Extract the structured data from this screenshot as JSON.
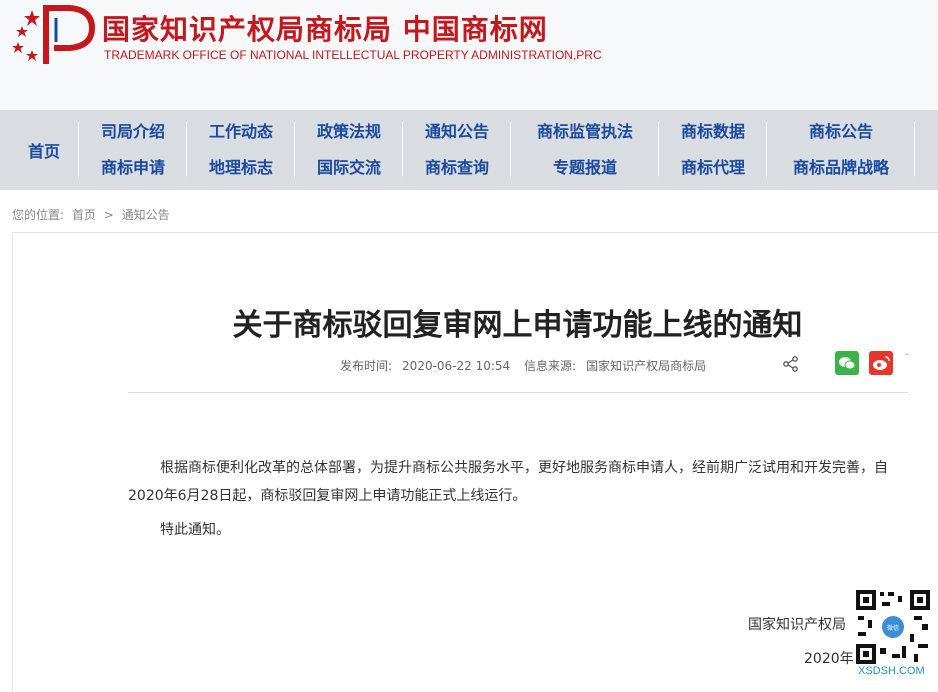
{
  "header": {
    "title_cn": "国家知识产权局商标局 中国商标网",
    "title_en": "TRADEMARK OFFICE OF NATIONAL INTELLECTUAL PROPERTY ADMINISTRATION,PRC",
    "brand_color": "#c4181c"
  },
  "nav": {
    "home": "首页",
    "columns": [
      {
        "top": "司局介绍",
        "bottom": "商标申请"
      },
      {
        "top": "工作动态",
        "bottom": "地理标志"
      },
      {
        "top": "政策法规",
        "bottom": "国际交流"
      },
      {
        "top": "通知公告",
        "bottom": "商标查询"
      },
      {
        "top": "商标监管执法",
        "bottom": "专题报道"
      },
      {
        "top": "商标数据",
        "bottom": "商标代理"
      },
      {
        "top": "商标公告",
        "bottom": "商标品牌战略"
      }
    ],
    "link_color": "#1a4aa0"
  },
  "breadcrumb": {
    "label": "您的位置:",
    "home": "首页",
    "sep": ">",
    "current": "通知公告"
  },
  "article": {
    "title": "关于商标驳回复审网上申请功能上线的通知",
    "publish_label": "发布时间:",
    "publish_time": "2020-06-22 10:54",
    "source_label": "信息来源:",
    "source": "国家知识产权局商标局",
    "dash": "-",
    "paragraph1": "根据商标便利化改革的总体部署，为提升商标公共服务水平，更好地服务商标申请人，经前期广泛试用和开发完善，自2020年6月28日起，商标驳回复审网上申请功能正式上线运行。",
    "paragraph2": "特此通知。",
    "signature": "国家知识产权局",
    "date": "2020年"
  },
  "watermark": {
    "label": "XSDSH.COM"
  },
  "icons": {
    "share": "share-icon",
    "wechat": "wechat-icon",
    "weibo": "weibo-icon",
    "logo": "trademark-logo-icon"
  }
}
